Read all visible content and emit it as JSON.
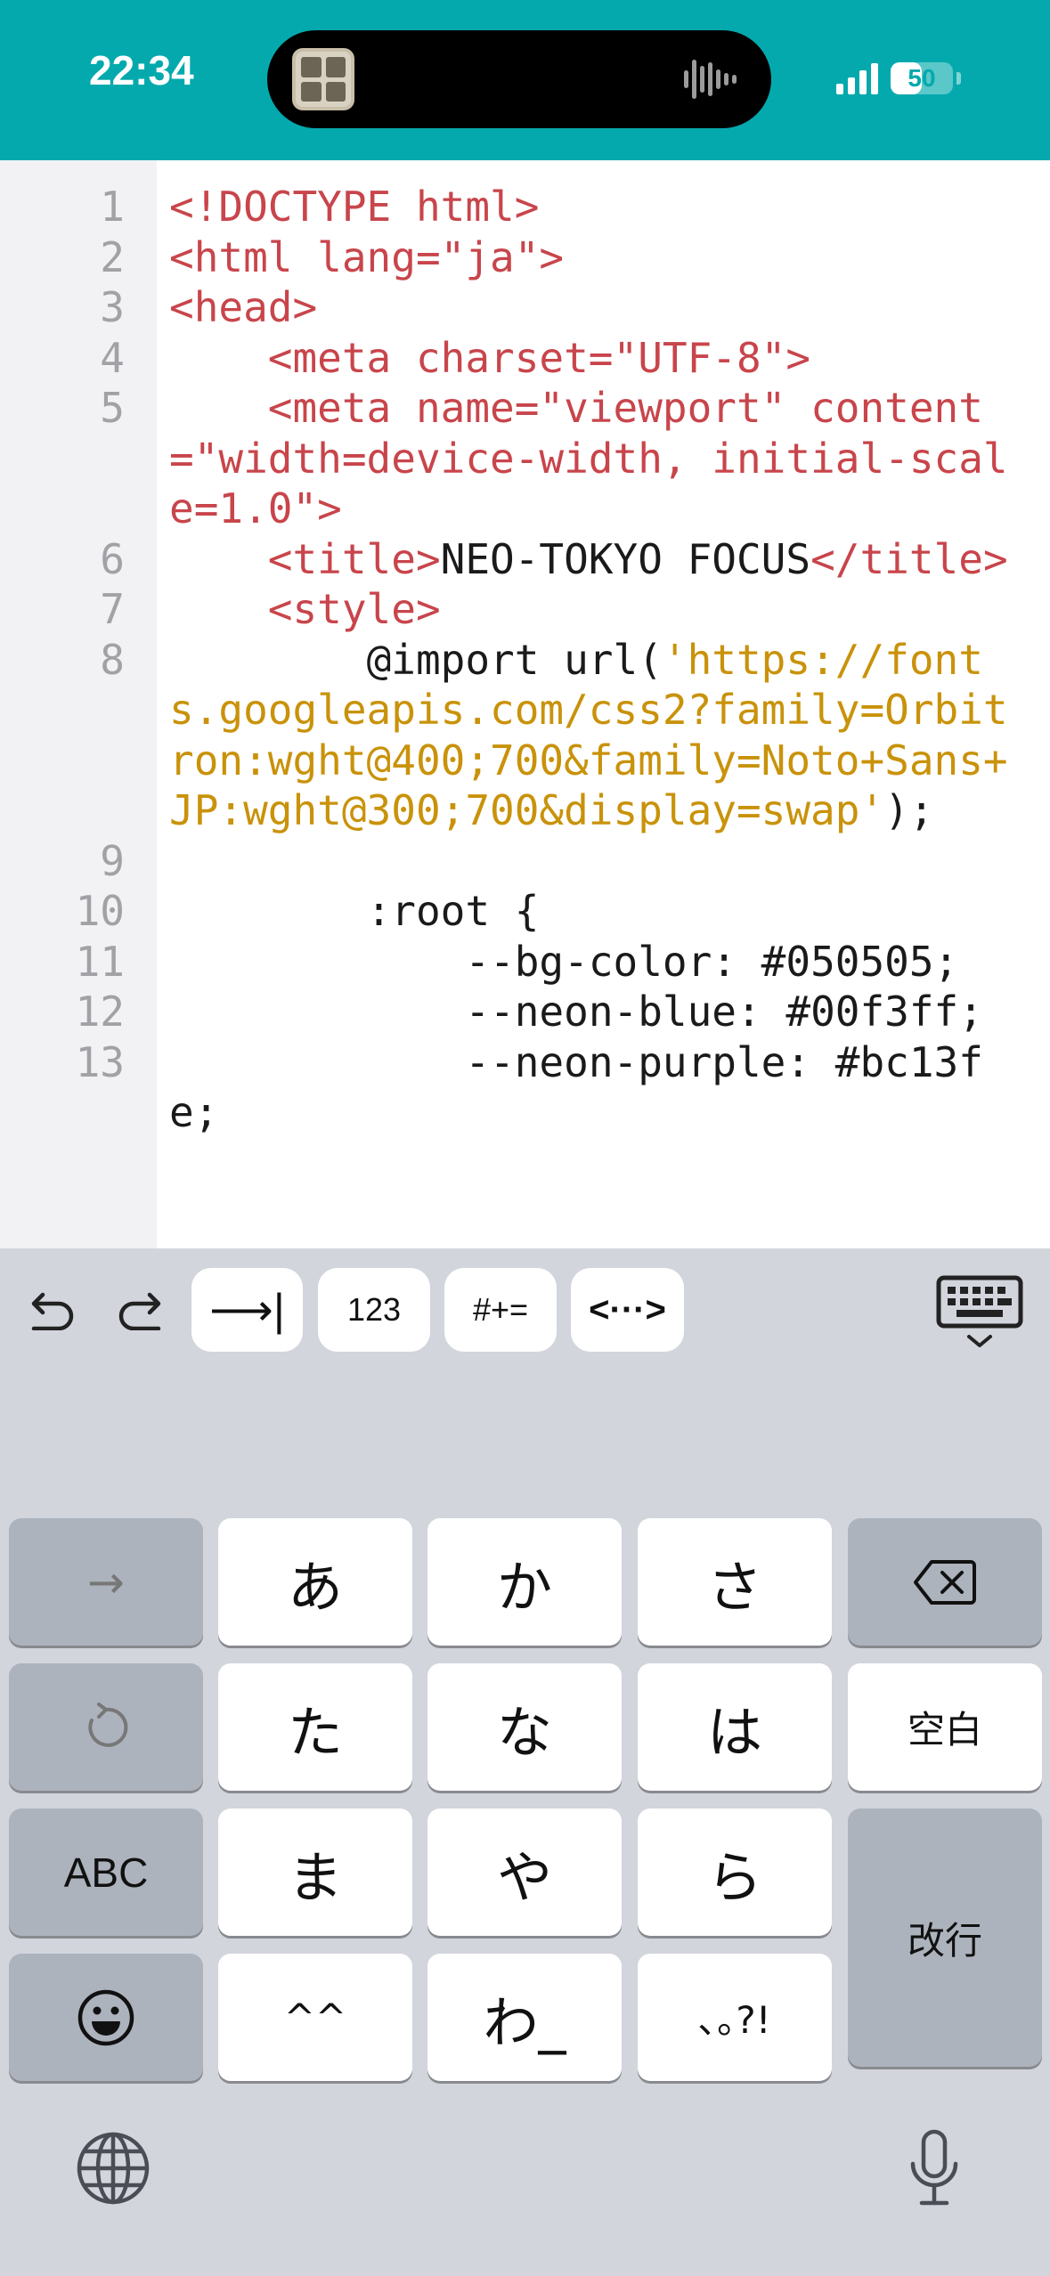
{
  "status_bar": {
    "time": "22:34",
    "battery_percent": 50,
    "battery_label": "50",
    "background": "#04a9ad"
  },
  "editor": {
    "tag_color": "#c8454b",
    "string_color": "#c9920a",
    "lines": [
      {
        "n": "1",
        "segs": [
          {
            "t": "<!DOCTYPE html>",
            "c": "tag"
          }
        ]
      },
      {
        "n": "2",
        "segs": [
          {
            "t": "<html lang=\"ja\">",
            "c": "tag"
          }
        ]
      },
      {
        "n": "3",
        "segs": [
          {
            "t": "<head>",
            "c": "tag"
          }
        ]
      },
      {
        "n": "4",
        "segs": [
          {
            "t": "    <meta charset=\"UTF-8\">",
            "c": "tag"
          }
        ]
      },
      {
        "n": "5",
        "segs": [
          {
            "t": "    <meta name=\"viewport\" ",
            "c": "tag"
          },
          {
            "t": "content=\"width=device-width, initial-scale=1.0\">",
            "c": "tag"
          }
        ]
      },
      {
        "n": "6",
        "segs": [
          {
            "t": "    <title>",
            "c": "tag"
          },
          {
            "t": "NEO-TOKYO FOCUS",
            "c": "txt"
          },
          {
            "t": "</title>",
            "c": "tag"
          }
        ]
      },
      {
        "n": "7",
        "segs": [
          {
            "t": "    <style>",
            "c": "tag"
          }
        ]
      },
      {
        "n": "8",
        "segs": [
          {
            "t": "        @import url(",
            "c": "txt"
          },
          {
            "t": "'https://fonts.googleapis.com/css2?family=Orbitron:wght@400;700&family=Noto+Sans+JP:wght@300;700&display=swap'",
            "c": "str"
          },
          {
            "t": ");",
            "c": "txt"
          }
        ]
      },
      {
        "n": "9",
        "segs": [
          {
            "t": "",
            "c": "txt"
          }
        ]
      },
      {
        "n": "10",
        "segs": [
          {
            "t": "        :root {",
            "c": "txt"
          }
        ]
      },
      {
        "n": "11",
        "segs": [
          {
            "t": "            --bg-color: #050505;",
            "c": "txt"
          }
        ]
      },
      {
        "n": "12",
        "segs": [
          {
            "t": "            --neon-blue: #00f3ff;",
            "c": "txt"
          }
        ]
      },
      {
        "n": "13",
        "segs": [
          {
            "t": "            --neon-purple: #bc13fe;",
            "c": "txt"
          }
        ]
      }
    ]
  },
  "toolbar": {
    "undo_icon": "undo-icon",
    "redo_icon": "redo-icon",
    "tab_label": "⟶|",
    "num_label": "123",
    "sym_label": "#+=",
    "tags_label": "<···>",
    "dismiss_icon": "keyboard-dismiss-icon"
  },
  "keyboard": {
    "rows": [
      [
        "→",
        "あ",
        "か",
        "さ",
        "⌫"
      ],
      [
        "↺",
        "た",
        "な",
        "は",
        "空白"
      ],
      [
        "ABC",
        "ま",
        "や",
        "ら",
        "改行"
      ],
      [
        "☺",
        "^^",
        "わ_",
        "､｡?!"
      ]
    ],
    "globe_icon": "globe-icon",
    "mic_icon": "microphone-icon"
  }
}
